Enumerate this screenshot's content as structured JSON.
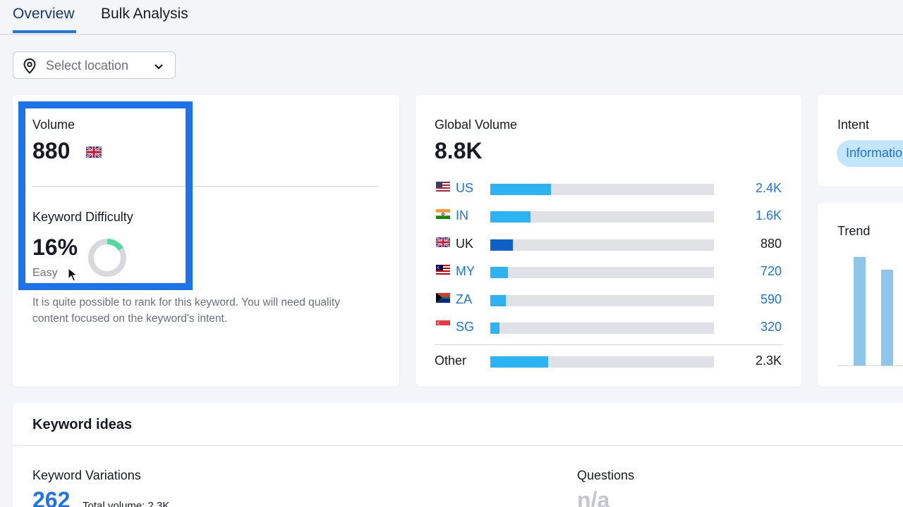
{
  "tabs": {
    "overview": "Overview",
    "bulk": "Bulk Analysis"
  },
  "location": {
    "placeholder": "Select location"
  },
  "volume": {
    "label": "Volume",
    "value": "880",
    "flag_country": "UK"
  },
  "keyword_difficulty": {
    "label": "Keyword Difficulty",
    "value": "16%",
    "percent": 16,
    "level": "Easy",
    "description": "It is quite possible to rank for this keyword. You will need quality content focused on the keyword's intent."
  },
  "global_volume": {
    "label": "Global Volume",
    "value": "8.8K",
    "countries": [
      {
        "code": "US",
        "value": "2.4K",
        "share": 0.27
      },
      {
        "code": "IN",
        "value": "1.6K",
        "share": 0.18
      },
      {
        "code": "UK",
        "value": "880",
        "share": 0.1
      },
      {
        "code": "MY",
        "value": "720",
        "share": 0.08
      },
      {
        "code": "ZA",
        "value": "590",
        "share": 0.07
      },
      {
        "code": "SG",
        "value": "320",
        "share": 0.04
      }
    ],
    "other": {
      "label": "Other",
      "value": "2.3K",
      "share": 0.26
    }
  },
  "intent": {
    "label": "Intent",
    "value": "Informational"
  },
  "trend": {
    "label": "Trend",
    "values": [
      100,
      88
    ]
  },
  "keyword_ideas": {
    "title": "Keyword ideas",
    "variations": {
      "label": "Keyword Variations",
      "value": "262",
      "total": "Total volume: 2.3K"
    },
    "questions": {
      "label": "Questions",
      "value": "n/a"
    }
  },
  "colors": {
    "accent": "#1e73e8",
    "bar": "#2bb3f3",
    "bar_uk": "#0d60c7",
    "highlight": "#1e73e8",
    "track": "#dfe1e7"
  }
}
